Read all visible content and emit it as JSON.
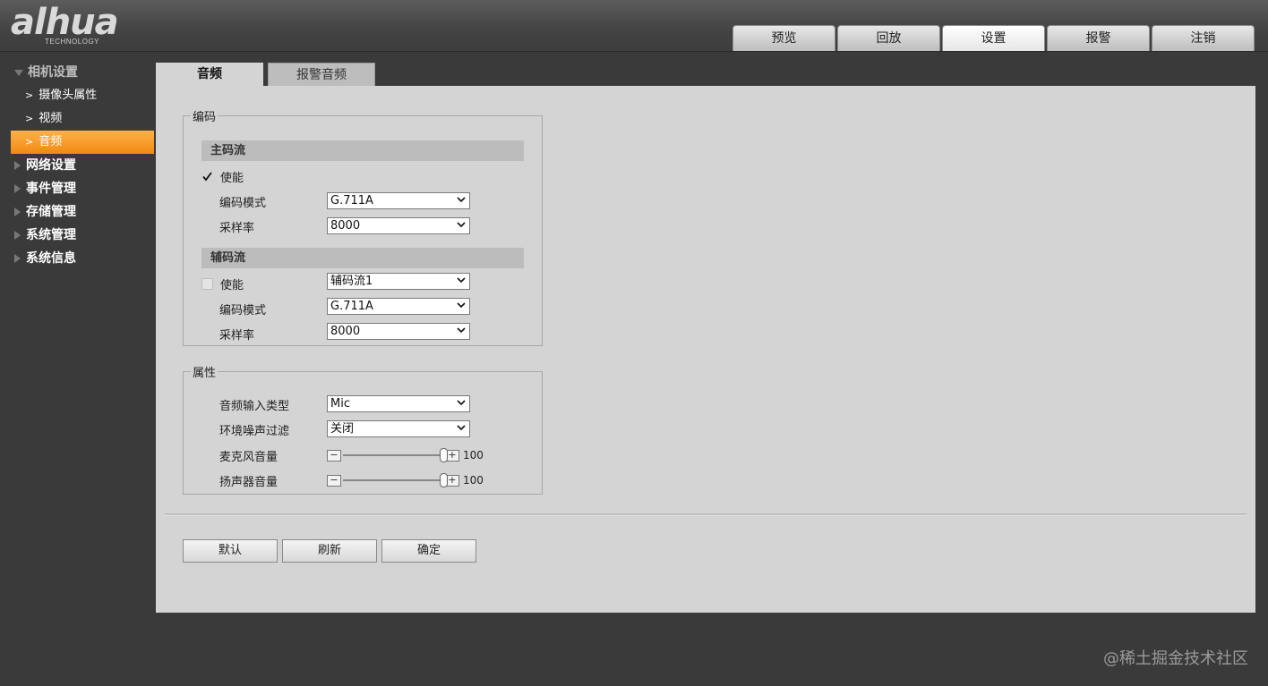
{
  "header": {
    "logo_text": "alhua",
    "logo_sub": "TECHNOLOGY",
    "tabs": [
      {
        "label": "预览"
      },
      {
        "label": "回放"
      },
      {
        "label": "设置"
      },
      {
        "label": "报警"
      },
      {
        "label": "注销"
      }
    ],
    "active_tab": "设置"
  },
  "sidebar": {
    "group_camera": "相机设置",
    "items": [
      {
        "label": "摄像头属性"
      },
      {
        "label": "视频"
      },
      {
        "label": "音频"
      }
    ],
    "groups": [
      {
        "label": "网络设置"
      },
      {
        "label": "事件管理"
      },
      {
        "label": "存储管理"
      },
      {
        "label": "系统管理"
      },
      {
        "label": "系统信息"
      }
    ]
  },
  "subtabs": {
    "audio": "音频",
    "alarm_audio": "报警音频"
  },
  "encode": {
    "legend": "编码",
    "main_stream": {
      "title": "主码流",
      "enable_label": "使能",
      "enabled": true,
      "mode_label": "编码模式",
      "mode_value": "G.711A",
      "rate_label": "采样率",
      "rate_value": "8000"
    },
    "sub_stream": {
      "title": "辅码流",
      "enable_label": "使能",
      "enabled": false,
      "stream_value": "辅码流1",
      "mode_label": "编码模式",
      "mode_value": "G.711A",
      "rate_label": "采样率",
      "rate_value": "8000"
    }
  },
  "attributes": {
    "legend": "属性",
    "input_type_label": "音频输入类型",
    "input_type_value": "Mic",
    "noise_filter_label": "环境噪声过滤",
    "noise_filter_value": "关闭",
    "mic_volume_label": "麦克风音量",
    "mic_volume_value": "100",
    "speaker_volume_label": "扬声器音量",
    "speaker_volume_value": "100",
    "minus": "−",
    "plus": "+"
  },
  "buttons": {
    "default": "默认",
    "refresh": "刷新",
    "ok": "确定"
  },
  "watermark": "@稀土掘金技术社区",
  "colors": {
    "accent": "#f59a23",
    "panel": "#d4d4d4",
    "background": "#3a3a3a"
  }
}
